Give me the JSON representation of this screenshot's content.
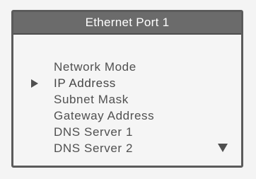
{
  "header": {
    "title": "Ethernet Port 1"
  },
  "menu": {
    "selected_index": 1,
    "items": [
      {
        "label": "Network Mode"
      },
      {
        "label": "IP Address"
      },
      {
        "label": "Subnet Mask"
      },
      {
        "label": "Gateway Address"
      },
      {
        "label": "DNS Server 1"
      },
      {
        "label": "DNS Server 2"
      }
    ]
  },
  "icons": {
    "cursor": "selection-arrow-right-icon",
    "scroll": "scroll-down-triangle-icon"
  },
  "colors": {
    "title_bar": "#6b6b6b",
    "border": "#5b5b5b",
    "text": "#505050",
    "background": "#f5f5f5"
  }
}
